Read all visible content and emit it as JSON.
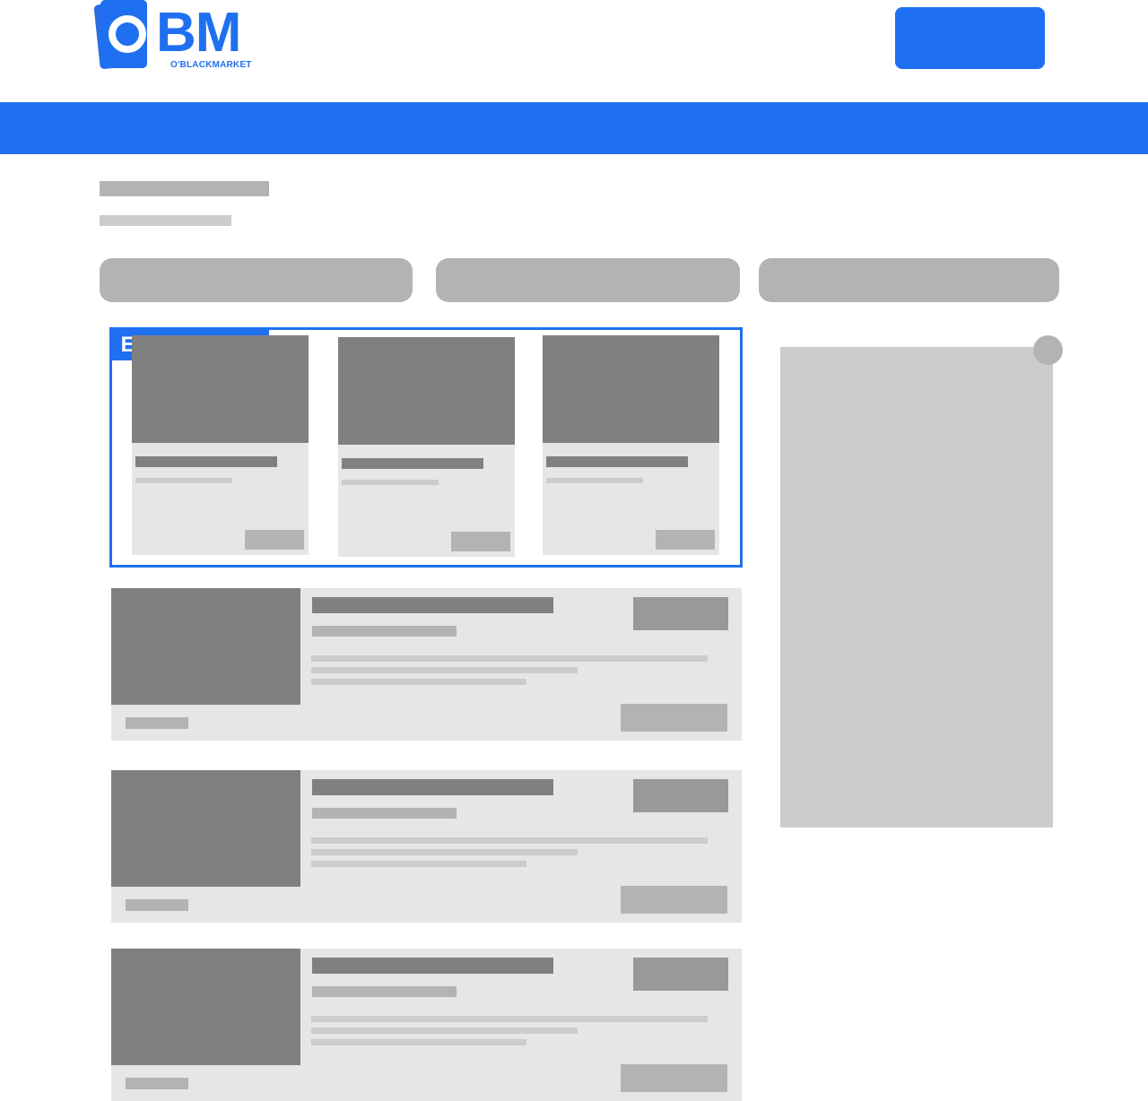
{
  "header": {
    "logo": {
      "monogram": "BM",
      "wordmark": "O'BLACKMARKET",
      "color": "#1f70f0"
    },
    "action_button": {
      "label": ""
    }
  },
  "featured": {
    "badge": "EN VEDETTE",
    "accent": "#1f70f0"
  },
  "colors": {
    "brand_blue": "#1f70f0",
    "placeholder_dark": "#808080",
    "placeholder_mid": "#b3b3b3",
    "placeholder_light": "#cccccc",
    "card_bg": "#e6e6e6"
  }
}
